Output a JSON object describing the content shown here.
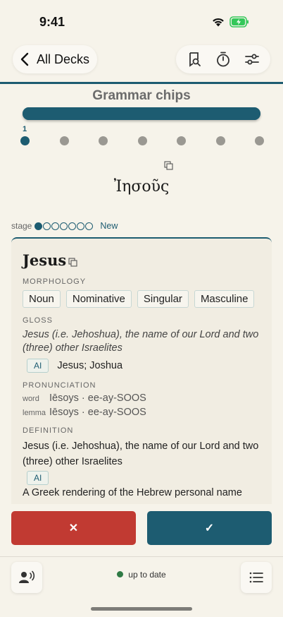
{
  "status_bar": {
    "time": "9:41"
  },
  "nav": {
    "back_label": "All Decks"
  },
  "deck": {
    "title": "Grammar chips",
    "current_step": "1",
    "total_steps": 7,
    "progress": 1.0
  },
  "headword": "Ἰησοῦς",
  "stage": {
    "label": "stage",
    "level": 1,
    "total": 7,
    "status": "New"
  },
  "card": {
    "word": "Jesus",
    "morphology_label": "MORPHOLOGY",
    "morphology": [
      "Noun",
      "Nominative",
      "Singular",
      "Masculine"
    ],
    "gloss_label": "GLOSS",
    "gloss": "Jesus (i.e. Jehoshua), the name of our Lord and two (three) other Israelites",
    "ai_badge": "AI",
    "ai_gloss": "Jesus; Joshua",
    "pronunciation_label": "PRONUNCIATION",
    "pron_word_key": "word",
    "pron_word": "Iēsoys · ee-ay-SOOS",
    "pron_lemma_key": "lemma",
    "pron_lemma": "Iēsoys · ee-ay-SOOS",
    "definition_label": "DEFINITION",
    "definition": "Jesus (i.e. Jehoshua), the name of our Lord and two (three) other Israelites",
    "definition_ai": "A Greek rendering of the Hebrew personal name"
  },
  "answer": {
    "wrong": "✕",
    "right": "✓"
  },
  "footer": {
    "sync_status": "up to date",
    "sync_color": "#2f7a45"
  },
  "colors": {
    "accent": "#1d5c71",
    "wrong": "#c13a32",
    "background": "#f6f3ea",
    "card": "#f1ede2"
  },
  "icons": [
    "wifi-icon",
    "battery-icon",
    "chevron-left-icon",
    "bookmark-search-icon",
    "timer-icon",
    "sliders-icon",
    "copy-icon",
    "speaker-icon",
    "list-icon"
  ]
}
